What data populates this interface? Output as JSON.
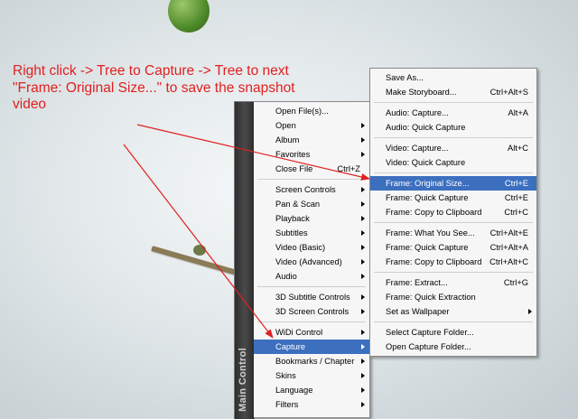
{
  "annotation": {
    "lines": [
      "Right click -> Tree to Capture -> Tree to next",
      "\"Frame: Original Size...\" to save the snapshot",
      "video"
    ],
    "color": "#e02020"
  },
  "sidebar": {
    "label": "Main Control"
  },
  "main_menu": {
    "items": [
      {
        "label": "Open File(s)...",
        "shortcut": "",
        "submenu": false
      },
      {
        "label": "Open",
        "shortcut": "",
        "submenu": true
      },
      {
        "label": "Album",
        "shortcut": "",
        "submenu": true
      },
      {
        "label": "Favorites",
        "shortcut": "",
        "submenu": true
      },
      {
        "label": "Close File",
        "shortcut": "Ctrl+Z",
        "submenu": false
      },
      {
        "separator": true
      },
      {
        "label": "Screen Controls",
        "shortcut": "",
        "submenu": true
      },
      {
        "label": "Pan & Scan",
        "shortcut": "",
        "submenu": true
      },
      {
        "label": "Playback",
        "shortcut": "",
        "submenu": true
      },
      {
        "label": "Subtitles",
        "shortcut": "",
        "submenu": true
      },
      {
        "label": "Video (Basic)",
        "shortcut": "",
        "submenu": true
      },
      {
        "label": "Video (Advanced)",
        "shortcut": "",
        "submenu": true
      },
      {
        "label": "Audio",
        "shortcut": "",
        "submenu": true
      },
      {
        "separator": true
      },
      {
        "label": "3D Subtitle Controls",
        "shortcut": "",
        "submenu": true
      },
      {
        "label": "3D Screen Controls",
        "shortcut": "",
        "submenu": true
      },
      {
        "separator": true
      },
      {
        "label": "WiDi Control",
        "shortcut": "",
        "submenu": true
      },
      {
        "label": "Capture",
        "shortcut": "",
        "submenu": true,
        "highlighted": true
      },
      {
        "label": "Bookmarks / Chapter",
        "shortcut": "",
        "submenu": true
      },
      {
        "label": "Skins",
        "shortcut": "",
        "submenu": true
      },
      {
        "label": "Language",
        "shortcut": "",
        "submenu": true
      },
      {
        "label": "Filters",
        "shortcut": "",
        "submenu": true
      }
    ]
  },
  "capture_menu": {
    "items": [
      {
        "label": "Save As...",
        "shortcut": ""
      },
      {
        "label": "Make Storyboard...",
        "shortcut": "Ctrl+Alt+S"
      },
      {
        "separator": true
      },
      {
        "label": "Audio: Capture...",
        "shortcut": "Alt+A"
      },
      {
        "label": "Audio: Quick Capture",
        "shortcut": ""
      },
      {
        "separator": true
      },
      {
        "label": "Video: Capture...",
        "shortcut": "Alt+C"
      },
      {
        "label": "Video: Quick Capture",
        "shortcut": ""
      },
      {
        "separator": true
      },
      {
        "label": "Frame: Original Size...",
        "shortcut": "Ctrl+E",
        "highlighted": true
      },
      {
        "label": "Frame: Quick Capture",
        "shortcut": "Ctrl+E"
      },
      {
        "label": "Frame: Copy to Clipboard",
        "shortcut": "Ctrl+C"
      },
      {
        "separator": true
      },
      {
        "label": "Frame: What You See...",
        "shortcut": "Ctrl+Alt+E"
      },
      {
        "label": "Frame: Quick Capture",
        "shortcut": "Ctrl+Alt+A"
      },
      {
        "label": "Frame: Copy to Clipboard",
        "shortcut": "Ctrl+Alt+C"
      },
      {
        "separator": true
      },
      {
        "label": "Frame: Extract...",
        "shortcut": "Ctrl+G"
      },
      {
        "label": "Frame: Quick Extraction",
        "shortcut": ""
      },
      {
        "label": "Set as Wallpaper",
        "shortcut": "",
        "submenu": true
      },
      {
        "separator": true
      },
      {
        "label": "Select Capture Folder...",
        "shortcut": ""
      },
      {
        "label": "Open Capture Folder...",
        "shortcut": ""
      }
    ]
  },
  "colors": {
    "highlight": "#3d6fbf",
    "menu_bg": "#f6f6f6",
    "arrow": "#e02020"
  }
}
